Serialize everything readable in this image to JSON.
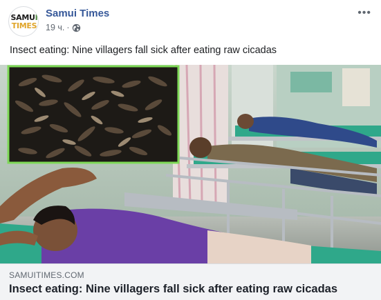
{
  "page": {
    "avatar_line1": "SAMU",
    "avatar_line1_accent": "I",
    "avatar_line2": "TIMES",
    "name": "Samui Times",
    "time": "19 ч.",
    "separator": "·",
    "privacy_icon": "globe-icon"
  },
  "post": {
    "text": "Insect eating: Nine villagers fall sick after eating raw cicadas"
  },
  "link_preview": {
    "domain": "SAMUITIMES.COM",
    "title": "Insect eating: Nine villagers fall sick after eating raw cicadas"
  },
  "colors": {
    "page_name": "#365899",
    "meta": "#606770",
    "link_box_bg": "#f2f3f5",
    "inset_border": "#7ed957",
    "bed_mattress": "#2fa88a"
  }
}
